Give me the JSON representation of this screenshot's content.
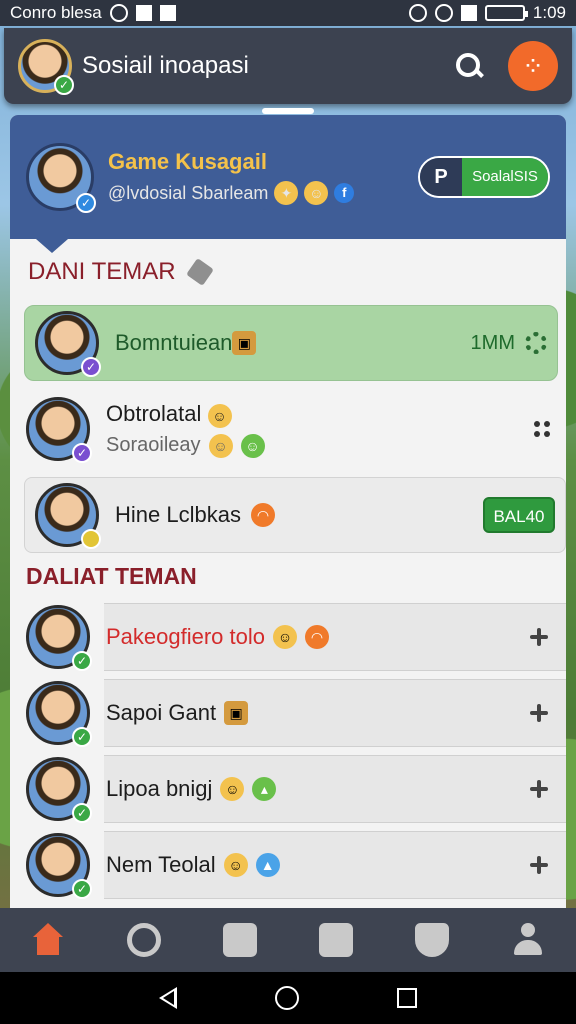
{
  "status_bar": {
    "carrier": "Conro blesa",
    "time": "1:09"
  },
  "app_bar": {
    "title": "Sosiail inoapasi",
    "fab_icon": "menu-dots-icon",
    "accent": "#f26a2a"
  },
  "profile": {
    "name": "Game Kusagail",
    "handle": "@lvdosial Sbarleam",
    "social_button_label": "SoalalSIS",
    "social_button_icon": "P"
  },
  "sections": {
    "primary_title": "DANI TEMAR",
    "secondary_title": "DALIAT TEMAN"
  },
  "primary_rows": [
    {
      "name": "Bomntuiean",
      "level": "1MM"
    },
    {
      "name": "Obtrolatal",
      "subtitle": "Soraoileay"
    },
    {
      "name": "Hine Lclbkas",
      "action_label": "BAL40"
    }
  ],
  "friends": [
    {
      "name": "Pakeogfiero tolo"
    },
    {
      "name": "Sapoi Gant"
    },
    {
      "name": "Lipoa bnigj"
    },
    {
      "name": "Nem Teolal"
    }
  ],
  "bottom_nav": [
    "home",
    "search",
    "mail",
    "inventory",
    "shield",
    "profile"
  ]
}
